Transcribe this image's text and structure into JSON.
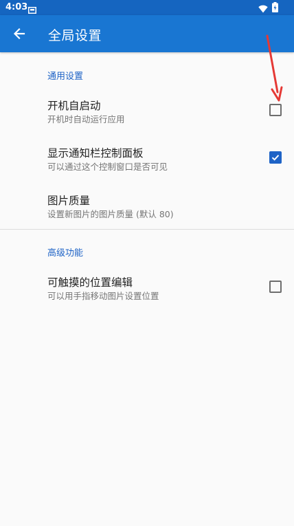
{
  "status_bar": {
    "time": "4:03"
  },
  "app_bar": {
    "title": "全局设置",
    "back_icon": "arrow-left-icon"
  },
  "sections": {
    "general": {
      "title": "通用设置"
    },
    "advanced": {
      "title": "高级功能"
    }
  },
  "prefs": {
    "autostart": {
      "title": "开机自启动",
      "summary": "开机时自动运行应用",
      "checked": false
    },
    "notification_panel": {
      "title": "显示通知栏控制面板",
      "summary": "可以通过这个控制窗口是否可见",
      "checked": true
    },
    "image_quality": {
      "title": "图片质量",
      "summary": "设置新图片的图片质量 (默认 80)"
    },
    "touch_edit": {
      "title": "可触摸的位置编辑",
      "summary": "可以用手指移动图片设置位置",
      "checked": false
    }
  },
  "colors": {
    "app_bar": "#1976d2",
    "status_bar": "#1565c0",
    "accent": "#1e63c6",
    "annotation": "#e53935"
  }
}
